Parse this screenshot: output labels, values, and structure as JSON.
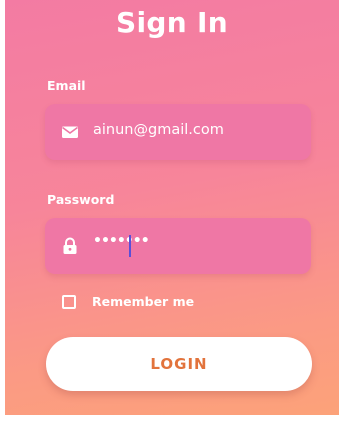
{
  "header": {
    "title": "Sign In"
  },
  "email": {
    "label": "Email",
    "icon": "mail-icon",
    "value": "ainun@gmail.com"
  },
  "password": {
    "label": "Password",
    "icon": "lock-icon",
    "value": "•••••••"
  },
  "remember": {
    "label": "Remember me",
    "checked": false
  },
  "login": {
    "label": "LOGIN"
  },
  "colors": {
    "gradient_top": "#f37ba3",
    "gradient_bottom": "#fca279",
    "input_background": "#ef77a5",
    "button_text": "#e2733c",
    "caret": "#5a4fd8"
  }
}
